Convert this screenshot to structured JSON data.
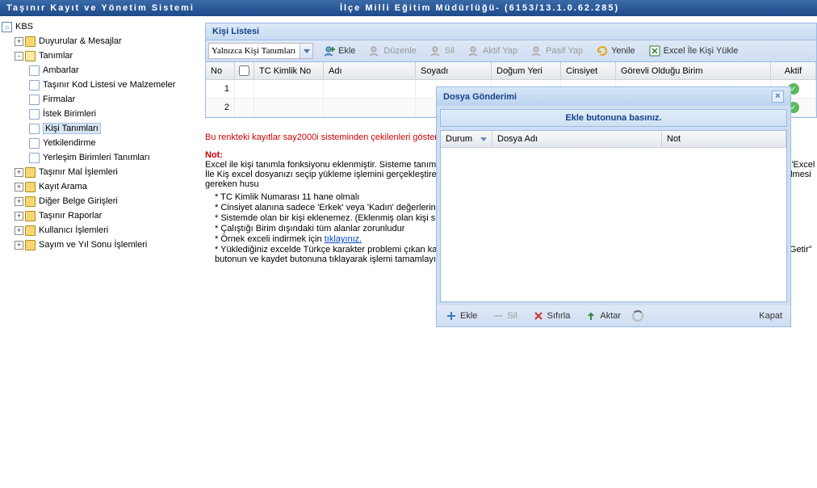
{
  "header": {
    "left": "Taşınır Kayıt ve Yönetim Sistemi",
    "right": "İlçe Milli Eğitim Müdürlüğü- (6153/13.1.0.62.285)"
  },
  "tree": {
    "root": "KBS",
    "n_duyurular": "Duyurular & Mesajlar",
    "n_tanimlar": "Tanımlar",
    "t_ambarlar": "Ambarlar",
    "t_kodlistesi": "Taşınır Kod Listesi ve Malzemeler",
    "t_firmalar": "Firmalar",
    "t_istek": "İstek Birimleri",
    "t_kisi": "Kişi Tanımları",
    "t_yetki": "Yetkilendirme",
    "t_yerlesim": "Yerleşim Birimleri Tanımları",
    "n_mal": "Taşınır Mal İşlemleri",
    "n_kayit": "Kayıt Arama",
    "n_diger": "Diğer Belge Girişleri",
    "n_rapor": "Taşınır Raporlar",
    "n_kullanici": "Kullanıcı İşlemleri",
    "n_sayim": "Sayım ve Yıl Sonu İşlemleri"
  },
  "panel": {
    "title": "Kişi Listesi",
    "combo": "Yalnızca Kişi Tanımları",
    "btn_ekle": "Ekle",
    "btn_duzenle": "Düzenle",
    "btn_sil": "Sil",
    "btn_aktif": "Aktif Yap",
    "btn_pasif": "Pasif Yap",
    "btn_yenile": "Yenile",
    "btn_excel": "Excel İle Kişi Yükle",
    "cols": {
      "no": "No",
      "tc": "TC Kimlik No",
      "ad": "Adı",
      "soyad": "Soyadı",
      "dogum": "Doğum Yeri",
      "cinsiyet": "Cinsiyet",
      "birim": "Görevli Olduğu Birim",
      "aktif": "Aktif"
    },
    "rows": [
      {
        "no": "1"
      },
      {
        "no": "2"
      }
    ]
  },
  "dialog": {
    "title": "Dosya Gönderimi",
    "banner": "Ekle butonuna basınız.",
    "cols": {
      "durum": "Durum",
      "dosya": "Dosya Adı",
      "not": "Not"
    },
    "btn_ekle": "Ekle",
    "btn_sil": "Sil",
    "btn_sifirla": "Sıfırla",
    "btn_aktar": "Aktar",
    "btn_kapat": "Kapat"
  },
  "notes": {
    "red1": "Bu renkteki kayıtlar say2000i sisteminden çekilenleri göstermektedir. Üzerinde değişiklik yapılamaz.",
    "title": "Not:",
    "p1": "Excel ile kişi tanımla fonksiyonu eklenmiştir. Sisteme tanımlamak istediğiniz kişilerin listesini örnek excel dosyasına uygun olarak doldurduktan sonra \"Excel İle Kiş excel dosyanızı seçip yükleme işlemini gerçekleştirebilirsiniz. Excel formatının örnek dosya ile birebir aynı olmasına özen gösteriniz. Dikkat edilmesi gereken husu",
    "b1": "TC Kimlik Numarası 11 hane olmalı",
    "b2": "Cinsiyet alanına sadece 'Erkek' veya 'Kadın' değerlerinden biri girilebilir (Küçük büyük harf duyarlı)",
    "b3": "Sistemde olan bir kişi eklenemez. (Eklenmiş olan kişi silinmiş olsa dahi)",
    "b4": "Çalıştığı Birim dışındaki tüm alanlar zorunludur",
    "b5a": "Örnek exceli indirmek için ",
    "b5link": "tıklayınız.",
    "b6": "Yüklediğiniz excelde Türkçe karakter problemi çıkan kayıtlar için; İlgili kaydı seçip düzenle butonuna basınız, T.C. Kimlik Numarasının yanındaki \"Getir\" butonun ve kaydet butonuna tıklayarak işlemi tamamlayınız."
  }
}
